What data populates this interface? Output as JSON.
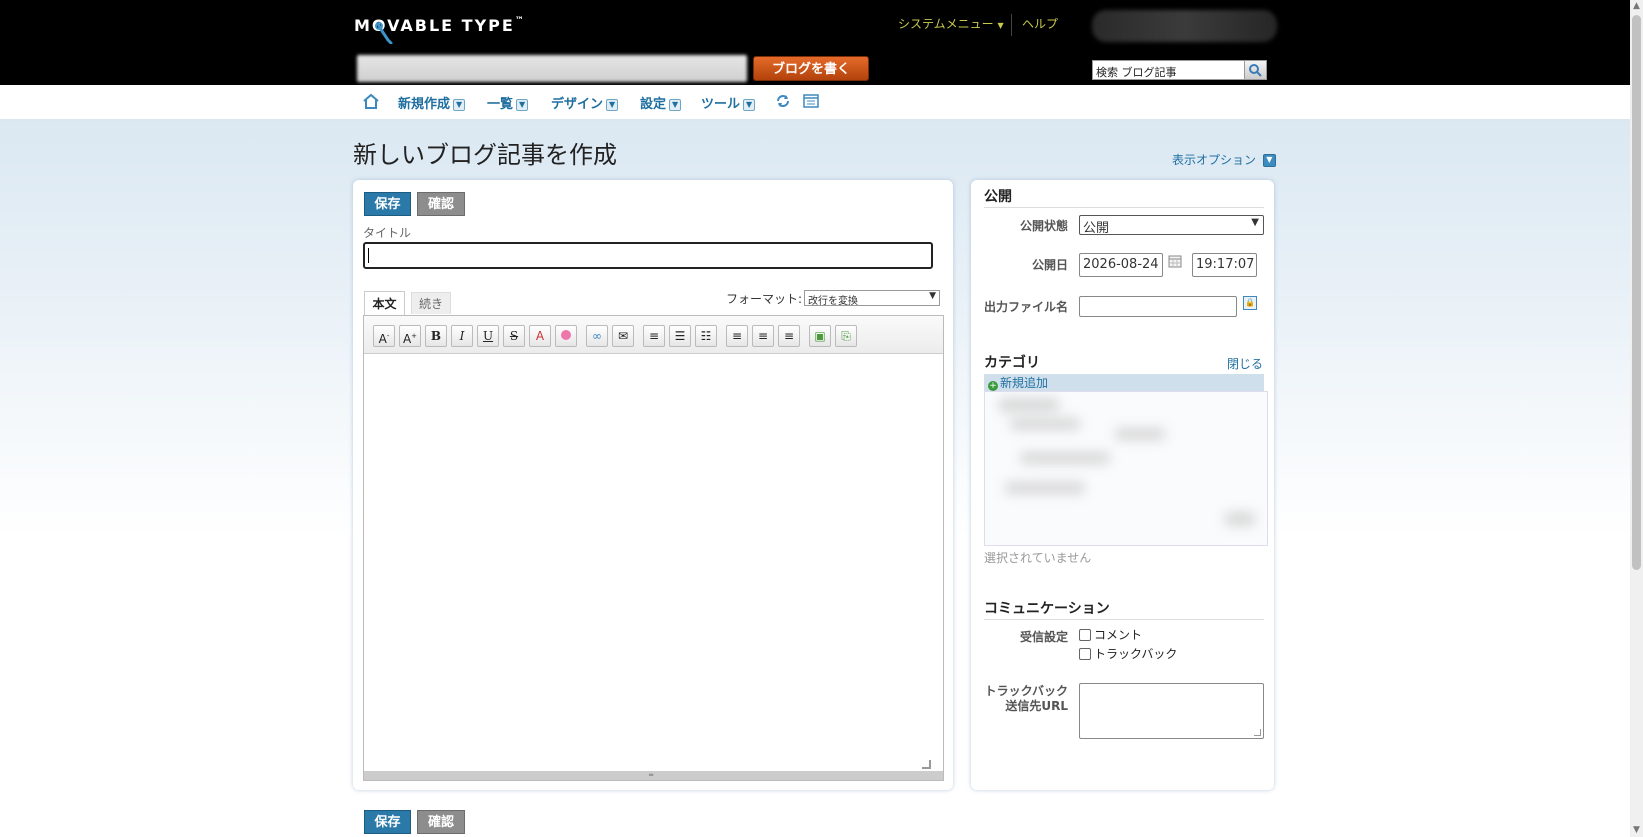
{
  "header": {
    "logo_text": "MOVABLE TYPE",
    "logo_tm": "™",
    "system_menu": "システムメニュー",
    "help": "ヘルプ",
    "write_button": "ブログを書く",
    "search_text": "検索 ブログ記事"
  },
  "nav": {
    "items": [
      {
        "label": "新規作成"
      },
      {
        "label": "一覧"
      },
      {
        "label": "デザイン"
      },
      {
        "label": "設定"
      },
      {
        "label": "ツール"
      }
    ]
  },
  "page": {
    "title": "新しいブログ記事を作成",
    "display_options": "表示オプション"
  },
  "editor": {
    "save_label": "保存",
    "preview_label": "確認",
    "title_label": "タイトル",
    "title_value": "",
    "tab_body": "本文",
    "tab_more": "続き",
    "format_label": "フォーマット:",
    "format_value": "改行を変換",
    "toolbar_icons": [
      "font-size-down-icon",
      "font-size-up-icon",
      "bold-icon",
      "italic-icon",
      "underline-icon",
      "strikethrough-icon",
      "text-color-icon",
      "background-color-icon",
      "link-icon",
      "email-link-icon",
      "indent-icon",
      "bullet-list-icon",
      "numbered-list-icon",
      "align-left-icon",
      "align-center-icon",
      "align-right-icon",
      "insert-image-icon",
      "insert-file-icon"
    ]
  },
  "publish": {
    "title": "公開",
    "status_label": "公開状態",
    "status_value": "公開",
    "date_label": "公開日",
    "date_value": "2026-08-24",
    "time_value": "19:17:07",
    "filename_label": "出力ファイル名",
    "filename_value": ""
  },
  "category": {
    "title": "カテゴリ",
    "close": "閉じる",
    "add_new": "新規追加",
    "none_selected": "選択されていません"
  },
  "communication": {
    "title": "コミュニケーション",
    "accept_label": "受信設定",
    "comment_label": "コメント",
    "trackback_label": "トラックバック",
    "trackback_url_label_1": "トラックバック",
    "trackback_url_label_2": "送信先URL"
  },
  "colors": {
    "accent": "#2b79a8",
    "header_bg": "#000000",
    "header_link": "#c7c94d",
    "write_button": "#d45a1a"
  }
}
